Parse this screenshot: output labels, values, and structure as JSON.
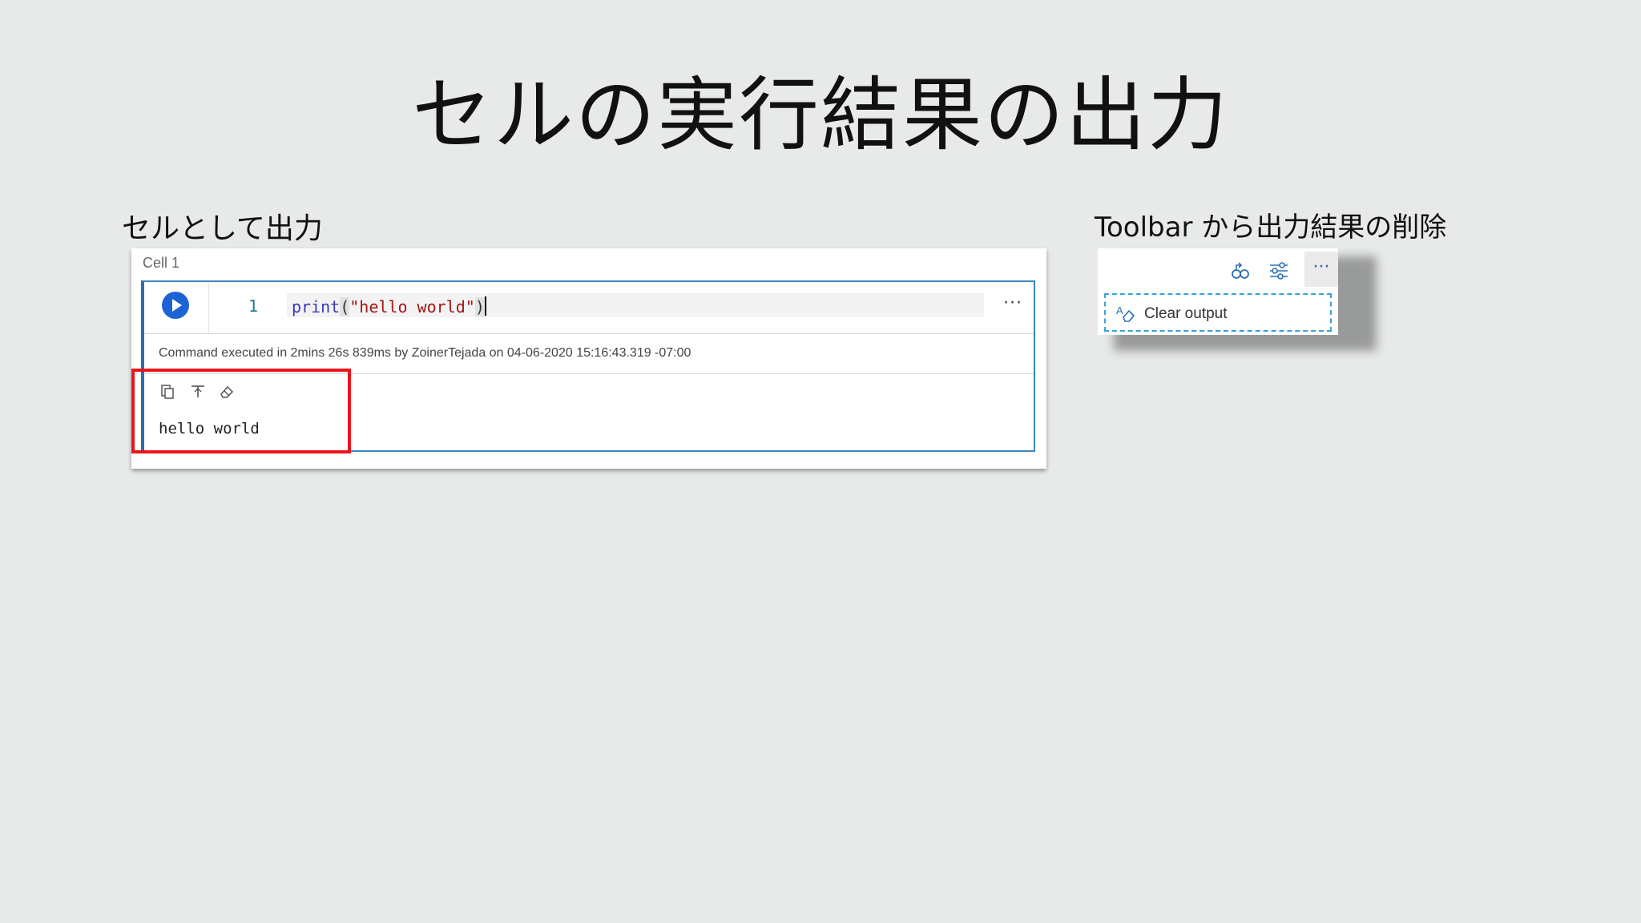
{
  "slide": {
    "title": "セルの実行結果の出力",
    "left_heading": "セルとして出力",
    "right_heading": "Toolbar から出力結果の削除"
  },
  "cell": {
    "label": "Cell 1",
    "line_number": "1",
    "code": {
      "fn": "print",
      "open_paren": "(",
      "string": "\"hello world\"",
      "close_paren": ")"
    },
    "more": "···",
    "execution_info": "Command executed in 2mins 26s 839ms by ZoinerTejada on 04-06-2020 15:16:43.319 -07:00",
    "output": "hello world",
    "output_tools": [
      "copy-icon",
      "top-align-icon",
      "eraser-icon"
    ],
    "highlight_color": "#e8161c"
  },
  "toolbar_panel": {
    "icons": [
      "variables-icon",
      "settings-sliders-icon"
    ],
    "more": "···",
    "clear_output_label": "Clear output"
  },
  "colors": {
    "background": "#e8eaea",
    "accent": "#3b86c4",
    "run_button": "#1e63d6"
  }
}
